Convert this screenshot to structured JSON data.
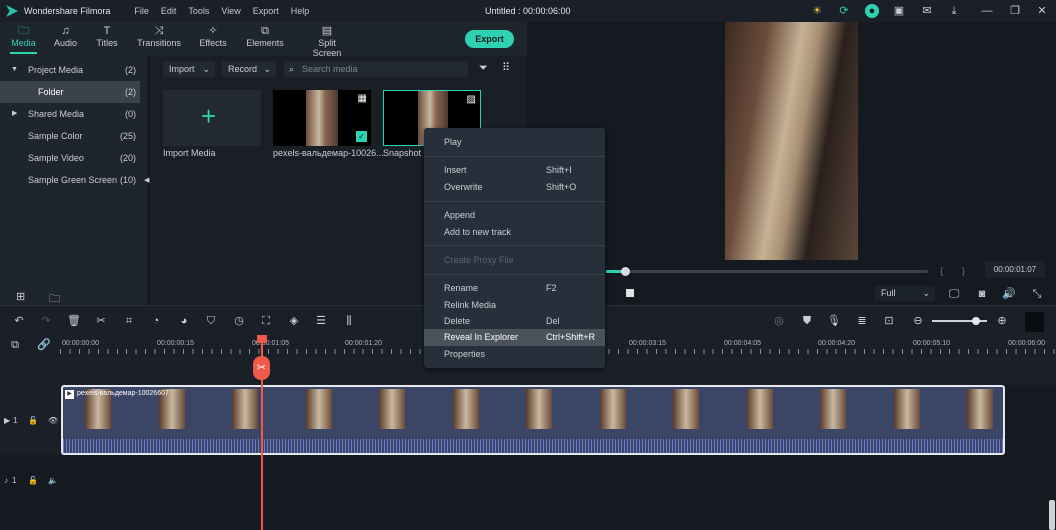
{
  "app": {
    "name": "Wondershare Filmora",
    "title": "Untitled : 00:00:06:00",
    "menu": [
      "File",
      "Edit",
      "Tools",
      "View",
      "Export",
      "Help"
    ]
  },
  "tabs": [
    {
      "label": "Media",
      "icon": "folder-icon"
    },
    {
      "label": "Audio",
      "icon": "music-icon"
    },
    {
      "label": "Titles",
      "icon": "text-icon"
    },
    {
      "label": "Transitions",
      "icon": "transitions-icon"
    },
    {
      "label": "Effects",
      "icon": "effects-icon"
    },
    {
      "label": "Elements",
      "icon": "elements-icon"
    },
    {
      "label": "Split Screen",
      "icon": "split-screen-icon"
    }
  ],
  "export_label": "Export",
  "sidebar": [
    {
      "label": "Project Media",
      "count": "(2)"
    },
    {
      "label": "Folder",
      "count": "(2)"
    },
    {
      "label": "Shared Media",
      "count": "(0)"
    },
    {
      "label": "Sample Color",
      "count": "(25)"
    },
    {
      "label": "Sample Video",
      "count": "(20)"
    },
    {
      "label": "Sample Green Screen",
      "count": "(10)"
    }
  ],
  "media": {
    "import": "Import",
    "record": "Record",
    "search_placeholder": "Search media",
    "items": [
      {
        "label": "Import Media"
      },
      {
        "label": "pexels-вальдемар-10026..."
      },
      {
        "label": "Snapshot"
      }
    ]
  },
  "context_menu": [
    {
      "label": "Play",
      "shortcut": ""
    },
    {
      "label": "Insert",
      "shortcut": "Shift+I"
    },
    {
      "label": "Overwrite",
      "shortcut": "Shift+O"
    },
    {
      "label": "Append",
      "shortcut": ""
    },
    {
      "label": "Add to new track",
      "shortcut": ""
    },
    {
      "label": "Create Proxy File",
      "shortcut": "",
      "disabled": true
    },
    {
      "label": "Rename",
      "shortcut": "F2"
    },
    {
      "label": "Relink Media",
      "shortcut": ""
    },
    {
      "label": "Delete",
      "shortcut": "Del"
    },
    {
      "label": "Reveal In Explorer",
      "shortcut": "Ctrl+Shift+R",
      "highlighted": true
    },
    {
      "label": "Properties",
      "shortcut": ""
    }
  ],
  "preview": {
    "timecode": "00:00:01:07",
    "quality": "Full",
    "progress_fraction": 0.06
  },
  "timeline": {
    "ruler": [
      "00:00:00:00",
      "00:00:00:15",
      "00:00:01:05",
      "00:00:01:20",
      "00:00:03:15",
      "00:00:04:05",
      "00:00:04:20",
      "00:00:05:10",
      "00:00:06:00"
    ],
    "clip_name": "pexels-вальдемар-10026607",
    "video_track": "1",
    "audio_track": "1",
    "zoom_fraction": 0.8
  },
  "colors": {
    "accent": "#2ed2b1",
    "playhead": "#f05a4a"
  }
}
